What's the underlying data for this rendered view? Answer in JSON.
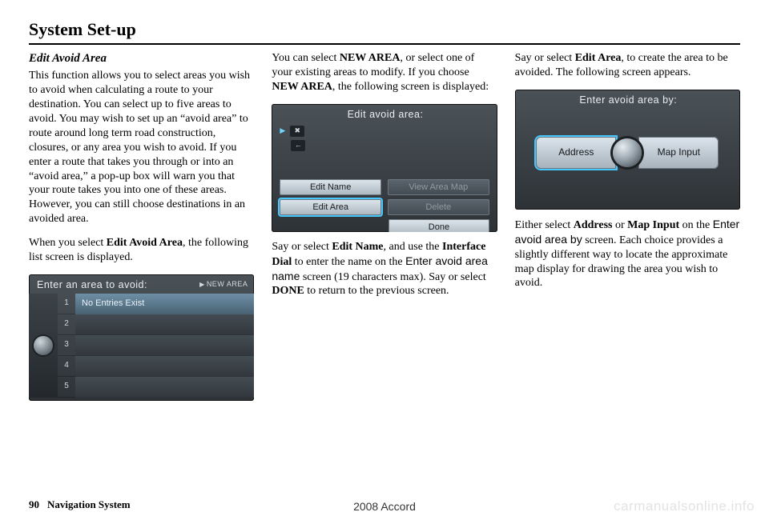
{
  "page_title": "System Set-up",
  "section_head": "Edit Avoid Area",
  "col1": {
    "para1": "This function allows you to select areas you wish to avoid when calculating a route to your destination. You can select up to five areas to avoid. You may wish to set up an “avoid area” to route around long term road construction, closures, or any area you wish to avoid. If you enter a route that takes you through or into an “avoid area,” a pop-up box will warn you that your route takes you into one of these areas. However, you can still choose destinations in an avoided area.",
    "para2_pre": "When you select ",
    "para2_bold": "Edit Avoid Area",
    "para2_post": ", the following list screen is displayed."
  },
  "screen1": {
    "title": "Enter an area to avoid:",
    "new_area": "NEW AREA",
    "row_text": "No Entries Exist",
    "nums": [
      "1",
      "2",
      "3",
      "4",
      "5"
    ]
  },
  "col2": {
    "p1_a": "You can select ",
    "p1_b1": "NEW AREA",
    "p1_c": ", or select one of your existing areas to modify. If you choose ",
    "p1_b2": "NEW AREA",
    "p1_d": ", the following screen is displayed:"
  },
  "screen2": {
    "title": "Edit avoid area:",
    "btn_edit_name": "Edit Name",
    "btn_view_map": "View Area Map",
    "btn_edit_area": "Edit Area",
    "btn_delete": "Delete",
    "btn_done": "Done"
  },
  "col2b": {
    "a": "Say or select ",
    "b1": "Edit Name",
    "c": ", and use the ",
    "b2": "Interface Dial",
    "d": " to enter the name on the ",
    "sans": "Enter avoid area name",
    "e": " screen (19 characters max). Say or select ",
    "b3": "DONE",
    "f": " to return to the previous screen."
  },
  "col3": {
    "a": "Say or select ",
    "b1": "Edit Area",
    "c": ", to create the area to be avoided. The following screen appears."
  },
  "screen3": {
    "title": "Enter avoid area by:",
    "address": "Address",
    "mapinput": "Map Input"
  },
  "col3b": {
    "a": "Either select ",
    "b1": "Address",
    "mid": " or ",
    "b2": "Map Input",
    "c": " on the ",
    "sans": "Enter avoid area by",
    "d": " screen. Each choice provides a slightly different way to locate the approximate map display for drawing the area you wish to avoid."
  },
  "footer": {
    "page_num": "90",
    "section": "Navigation System",
    "model": "2008  Accord",
    "watermark": "carmanualsonline.info"
  }
}
